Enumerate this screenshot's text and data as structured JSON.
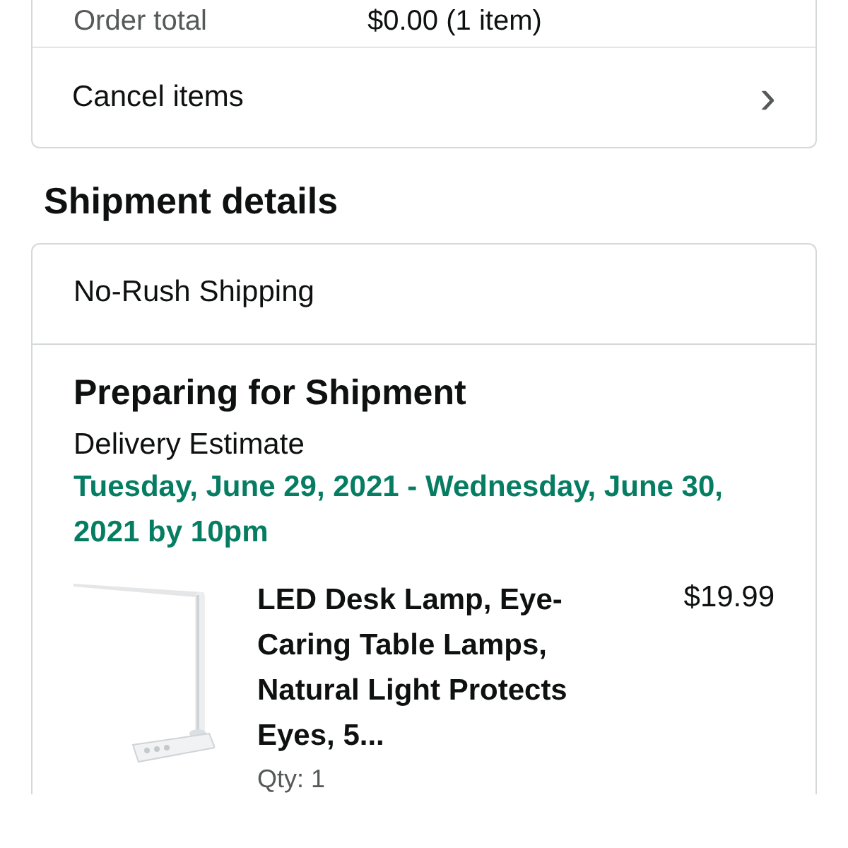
{
  "order_summary": {
    "rows": [
      {
        "label": "Order total",
        "value": "$0.00 (1 item)"
      }
    ],
    "actions": [
      {
        "label": "Cancel items",
        "icon": "›"
      }
    ]
  },
  "shipment": {
    "heading": "Shipment details",
    "speed": "No-Rush Shipping",
    "status": "Preparing for Shipment",
    "estimate_label": "Delivery Estimate",
    "estimate": "Tuesday, June 29, 2021 - Wednesday, June 30, 2021 by 10pm",
    "items": [
      {
        "title": "LED Desk Lamp, Eye-Caring Table Lamps, Natural Light Protects Eyes, 5...",
        "price": "$19.99",
        "quantity": "Qty: 1"
      }
    ]
  }
}
